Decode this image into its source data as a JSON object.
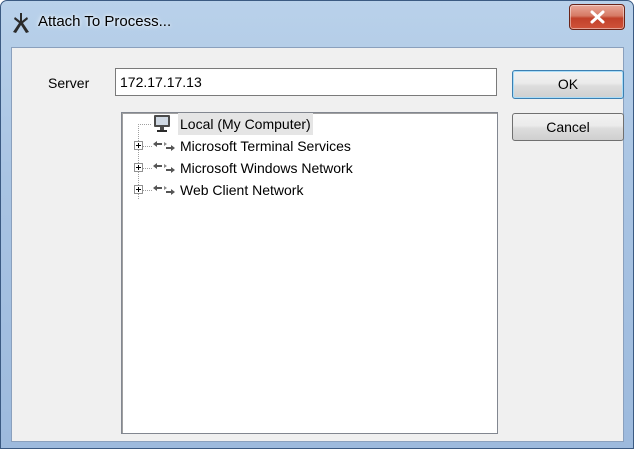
{
  "window": {
    "title": "Attach To Process...",
    "icons": {
      "app": "attach-process-icon",
      "close": "close-icon"
    }
  },
  "form": {
    "server_label": "Server",
    "server_value": "172.17.17.13"
  },
  "buttons": {
    "ok_label": "OK",
    "cancel_label": "Cancel"
  },
  "tree": {
    "items": [
      {
        "label": "Local (My Computer)",
        "icon": "computer-icon",
        "expandable": false
      },
      {
        "label": "Microsoft Terminal Services",
        "icon": "network-icon",
        "expandable": true
      },
      {
        "label": "Microsoft Windows Network",
        "icon": "network-icon",
        "expandable": true
      },
      {
        "label": "Web Client Network",
        "icon": "network-icon",
        "expandable": true
      }
    ]
  },
  "colors": {
    "titlebar": "#a9c4e3",
    "close_button": "#c1412a",
    "dialog_background": "#f0f0f0",
    "default_button_border": "#3c7fb1"
  }
}
